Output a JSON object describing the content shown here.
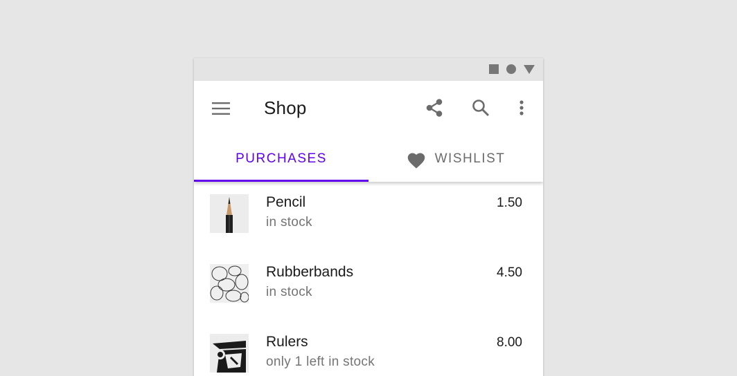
{
  "app_bar": {
    "title": "Shop",
    "icons": [
      "menu-icon",
      "share-icon",
      "search-icon",
      "more-vert-icon"
    ]
  },
  "status_bar": {
    "icons": [
      "square-icon",
      "circle-icon",
      "triangle-icon"
    ]
  },
  "tabs": [
    {
      "label": "PURCHASES",
      "active": true
    },
    {
      "label": "WISHLIST",
      "icon": "heart-icon",
      "active": false
    }
  ],
  "items": [
    {
      "title": "Pencil",
      "subtitle": "in stock",
      "price": "1.50",
      "thumb": "pencil-image"
    },
    {
      "title": "Rubberbands",
      "subtitle": "in stock",
      "price": "4.50",
      "thumb": "rubberbands-image"
    },
    {
      "title": "Rulers",
      "subtitle": "only 1 left in stock",
      "price": "8.00",
      "thumb": "rulers-image"
    }
  ],
  "colors": {
    "primary": "#6200ee",
    "background": "#e6e6e6",
    "status_bar": "#e4e4e4",
    "icon": "#6b6b6b"
  }
}
